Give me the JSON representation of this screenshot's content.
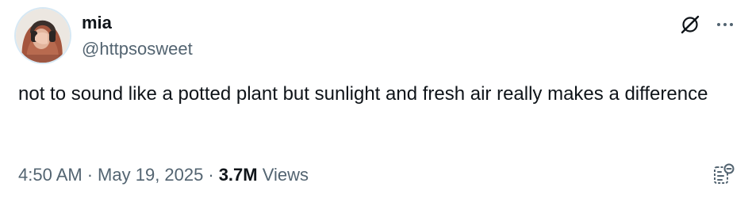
{
  "author": {
    "display_name": "mia",
    "handle": "@httpsosweet"
  },
  "tweet": {
    "text": "not to sound like a potted plant but sunlight and fresh air really makes a difference",
    "time": "4:50 AM",
    "separator": "·",
    "date": "May 19, 2025",
    "views_count": "3.7M",
    "views_label": "Views"
  },
  "icons": {
    "avatar": "profile-photo",
    "grok": "grok-slash-circle-icon",
    "more": "more-horizontal-icon",
    "analytics": "post-analytics-icon"
  },
  "colors": {
    "text_primary": "#0f1419",
    "text_secondary": "#536471",
    "background": "#ffffff"
  }
}
